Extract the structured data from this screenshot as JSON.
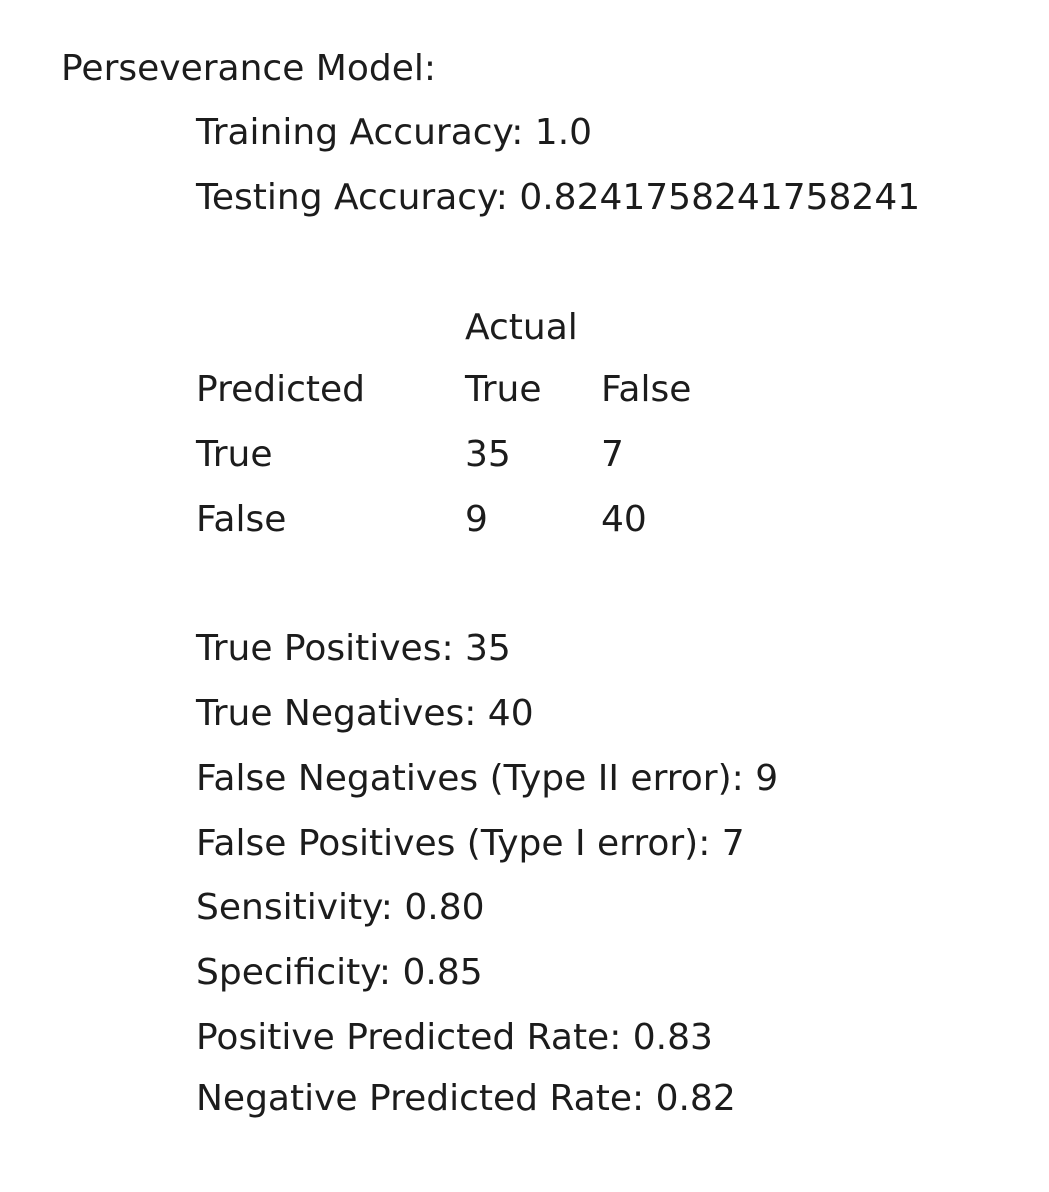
{
  "document": {
    "title": "Perseverance Model:",
    "training_accuracy": "Training Accuracy: 1.0",
    "testing_accuracy": "Testing Accuracy: 0.8241758241758241"
  },
  "confusion_matrix": {
    "actual_label": "Actual",
    "predicted_label": "Predicted",
    "col_true": "True",
    "col_false": "False",
    "row_true_label": "True",
    "row_false_label": "False",
    "tt": "35",
    "tf": "7",
    "ft": "9",
    "ff": "40"
  },
  "metrics": [
    "True Positives: 35",
    "True Negatives: 40",
    "False Negatives (Type II error): 9",
    "False Positives (Type I error): 7",
    "Sensitivity: 0.80",
    "Specificity: 0.85",
    "Positive Predicted Rate: 0.83",
    "Negative Predicted Rate: 0.82"
  ]
}
